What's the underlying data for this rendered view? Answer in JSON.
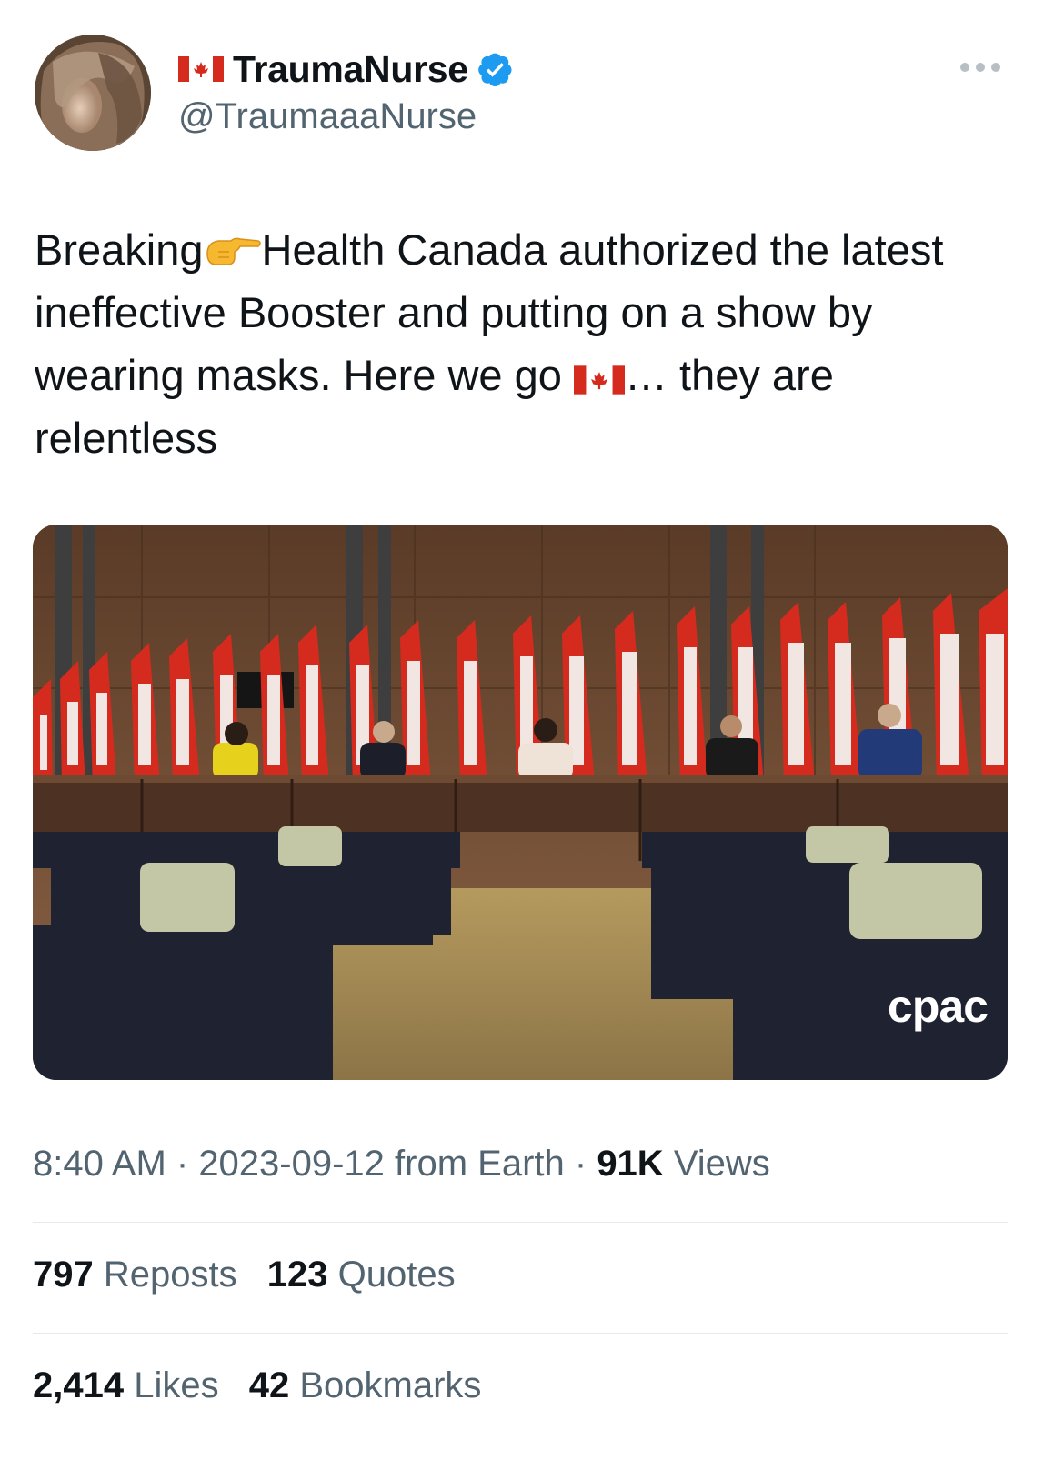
{
  "author": {
    "display_name": "TraumaNurse",
    "handle": "@TraumaaaNurse",
    "name_flag_icon": "canada-flag-icon",
    "verified_icon": "verified-badge-icon"
  },
  "tweet": {
    "text_part1": "Breaking",
    "pointing_icon": "pointing-right-hand-icon",
    "text_part2": "Health Canada authorized the latest ineffective Booster and putting on a show by wearing masks. Here we go ",
    "flag_icon": "canada-flag-icon",
    "text_part3": "… they are relentless"
  },
  "media": {
    "watermark": "cpac"
  },
  "meta": {
    "time": "8:40 AM",
    "separator": " · ",
    "date": "2023-09-12",
    "source": "from Earth",
    "views_count": "91K",
    "views_label": "Views"
  },
  "stats": {
    "reposts_count": "797",
    "reposts_label": "Reposts",
    "quotes_count": "123",
    "quotes_label": "Quotes",
    "likes_count": "2,414",
    "likes_label": "Likes",
    "bookmarks_count": "42",
    "bookmarks_label": "Bookmarks"
  },
  "colors": {
    "text_primary": "#0f1419",
    "text_secondary": "#536471",
    "verified_blue": "#1d9bf0",
    "flag_red": "#d52b1e",
    "divider": "#e7e9ea"
  }
}
